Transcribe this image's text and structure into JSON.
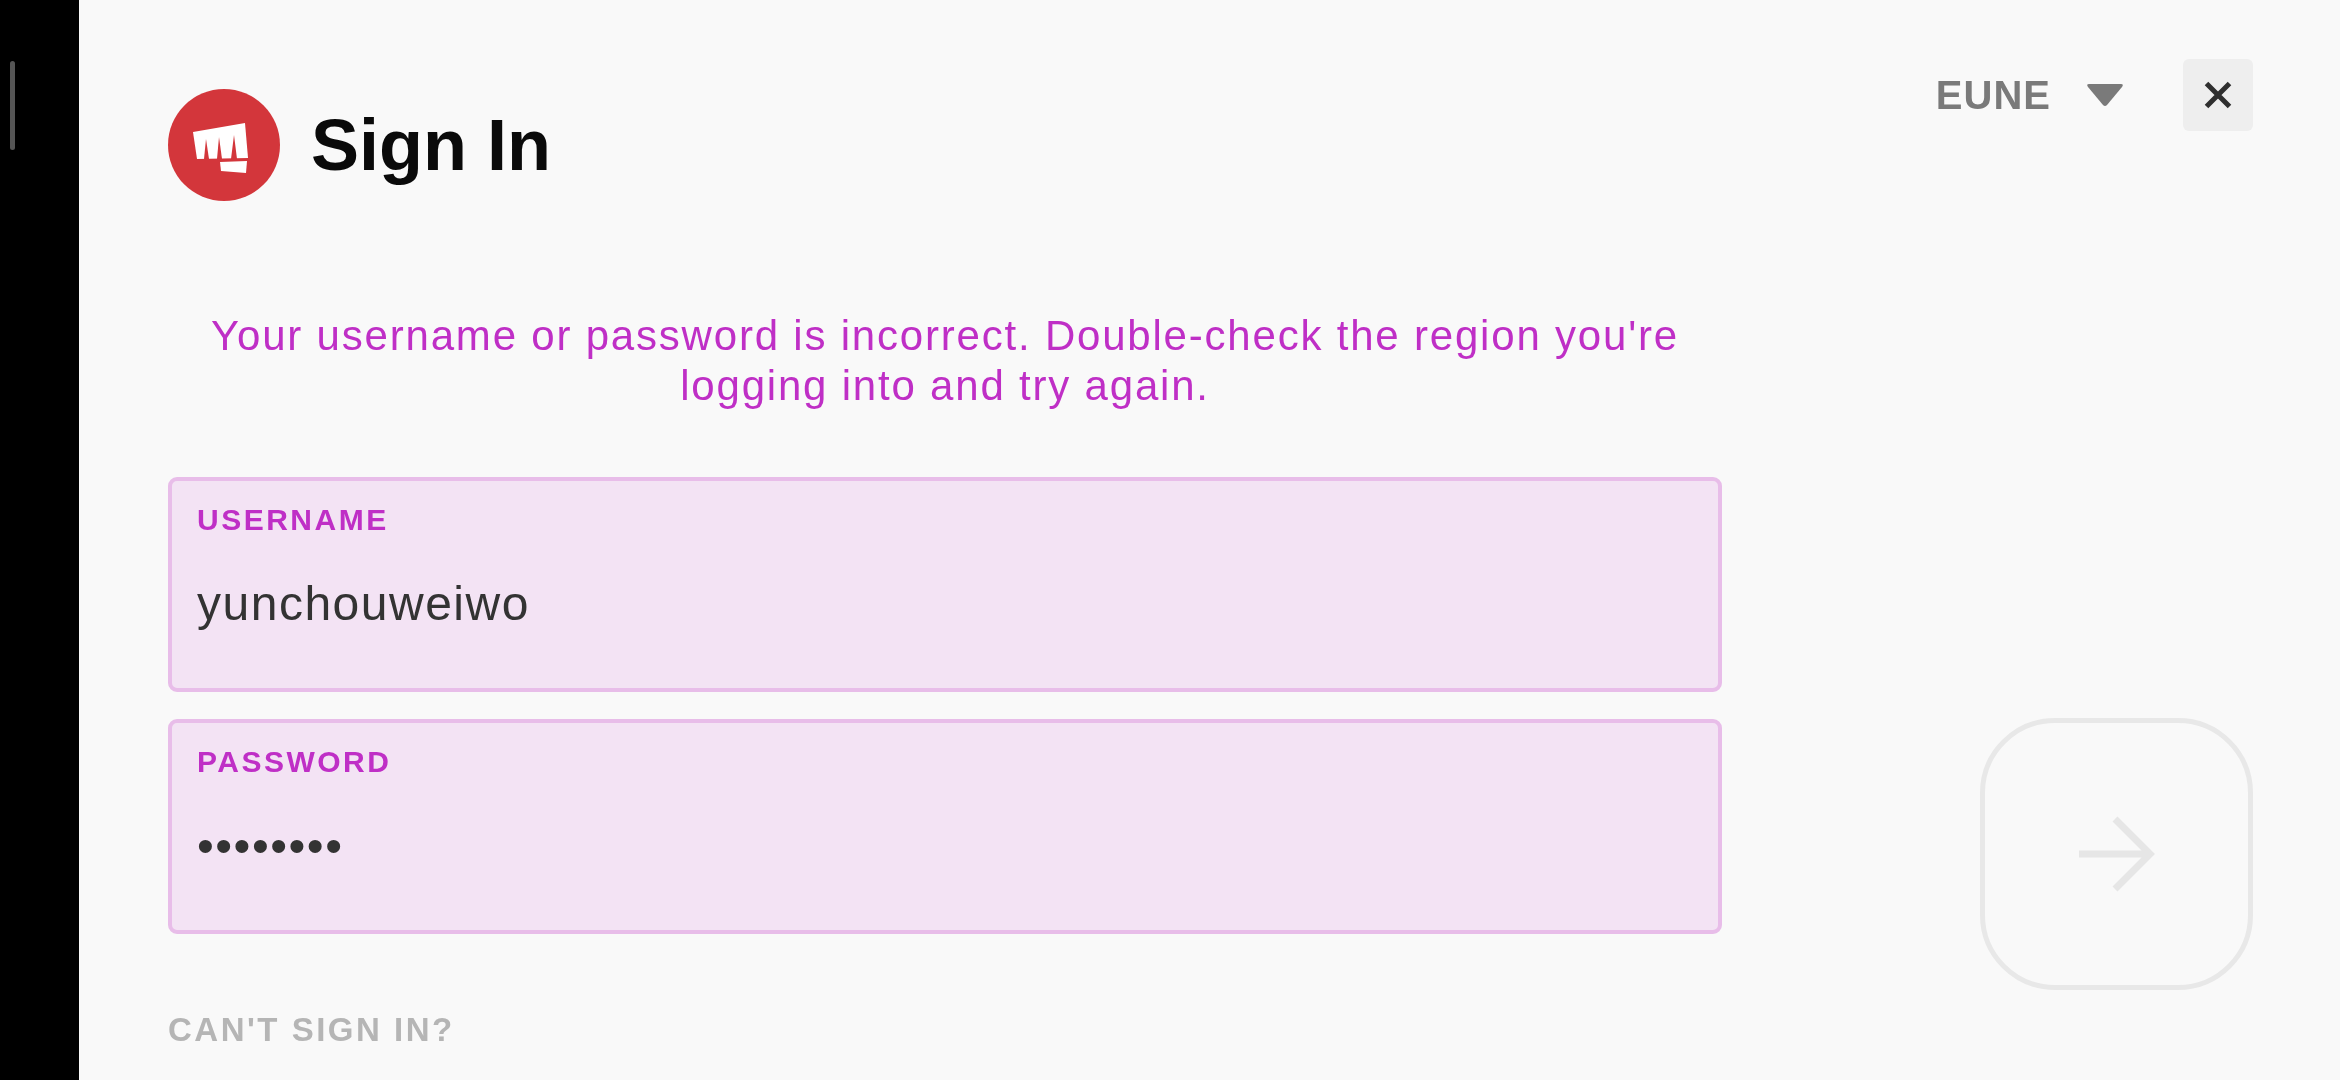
{
  "header": {
    "title": "Sign In"
  },
  "region_selector": {
    "label": "EUNE"
  },
  "error_message": "Your username or password is incorrect. Double-check the region you're logging into and try again.",
  "fields": [
    {
      "label": "USERNAME",
      "value": "yunchouweiwo",
      "error": true
    },
    {
      "label": "PASSWORD",
      "value": "••••••••",
      "error": true
    }
  ],
  "submit_button": {
    "disabled": true
  },
  "help_link": "CAN'T SIGN IN?"
}
